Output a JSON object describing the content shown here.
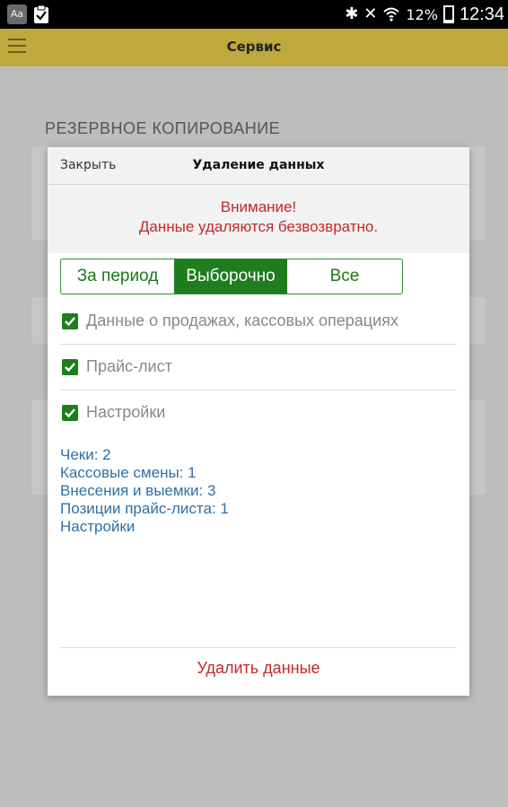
{
  "statusbar": {
    "battery_text": "12%",
    "time": "12:34",
    "icons": [
      "app-icon",
      "clipboard-icon",
      "bluetooth-icon",
      "mute-icon",
      "wifi-icon",
      "battery-icon"
    ]
  },
  "appbar": {
    "title": "Сервис"
  },
  "background": {
    "section_title": "РЕЗЕРВНОЕ КОПИРОВАНИЕ"
  },
  "dialog": {
    "close_label": "Закрыть",
    "title": "Удаление данных",
    "warning_line1": "Внимание!",
    "warning_line2": "Данные удаляются безвозвратно.",
    "segments": [
      "За период",
      "Выборочно",
      "Все"
    ],
    "selected_segment": "Выборочно",
    "checkboxes": [
      {
        "label": "Данные о продажах, кассовых операциях",
        "checked": true
      },
      {
        "label": "Прайс-лист",
        "checked": true
      },
      {
        "label": "Настройки",
        "checked": true
      }
    ],
    "stats": [
      "Чеки: 2",
      "Кассовые смены: 1",
      "Внесения и выемки: 3",
      "Позиции прайс-листа: 1",
      "Настройки"
    ],
    "delete_label": "Удалить данные"
  },
  "colors": {
    "accent_green": "#1e7e1e",
    "appbar": "#bfa93c",
    "warning_red": "#c62828",
    "stats_blue": "#2f6fa8"
  }
}
